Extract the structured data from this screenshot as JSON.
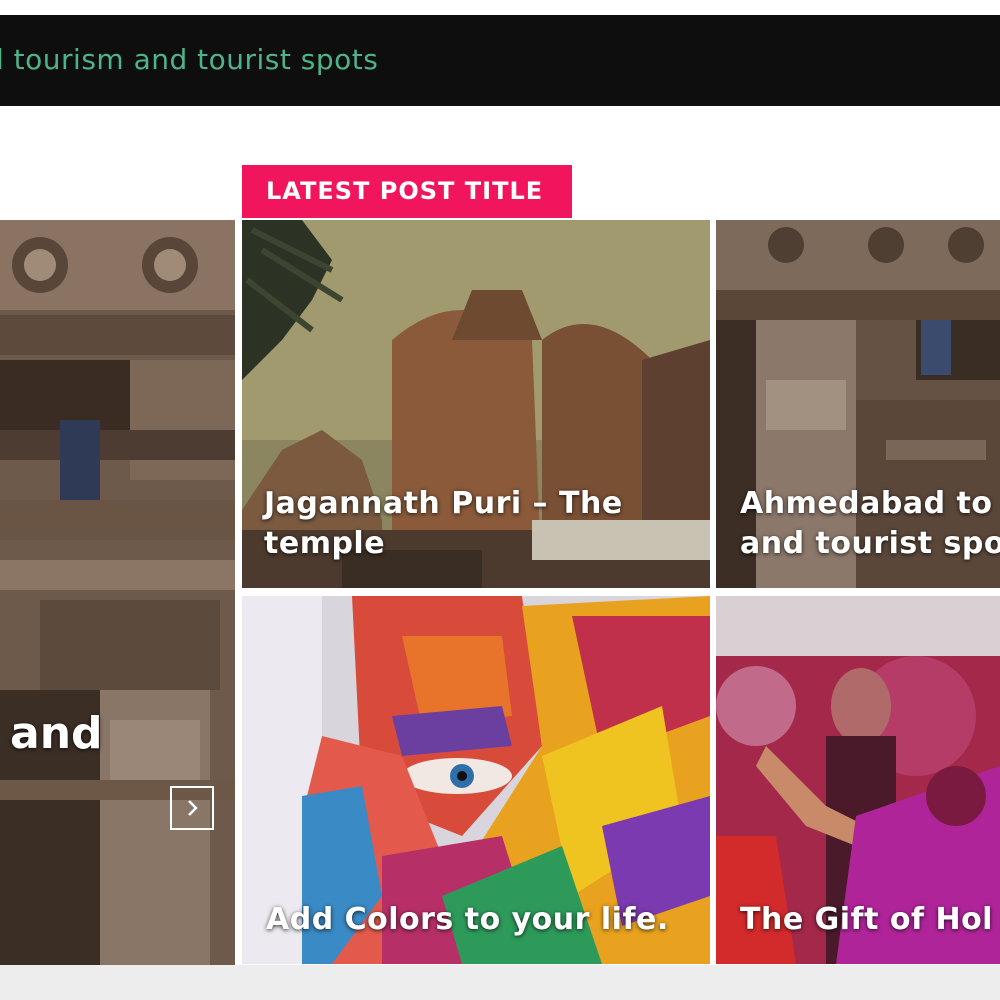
{
  "ticker": {
    "text": "d tourism and tourist spots"
  },
  "section": {
    "label": "LATEST POST TITLE"
  },
  "featured": {
    "partial_title": "and",
    "next_icon": "chevron-right-icon"
  },
  "posts": [
    {
      "title_line1": "Jagannath Puri – The",
      "title_line2": "temple"
    },
    {
      "title_line1": "Ahmedabad to",
      "title_line2": "and tourist spo"
    },
    {
      "title_line1": "Add Colors to your life.",
      "title_line2": ""
    },
    {
      "title_line1": "The Gift of Hol",
      "title_line2": ""
    }
  ],
  "colors": {
    "accent": "#f0155d",
    "ticker_bg": "#0e0e0e",
    "ticker_text": "#4fb38a"
  }
}
